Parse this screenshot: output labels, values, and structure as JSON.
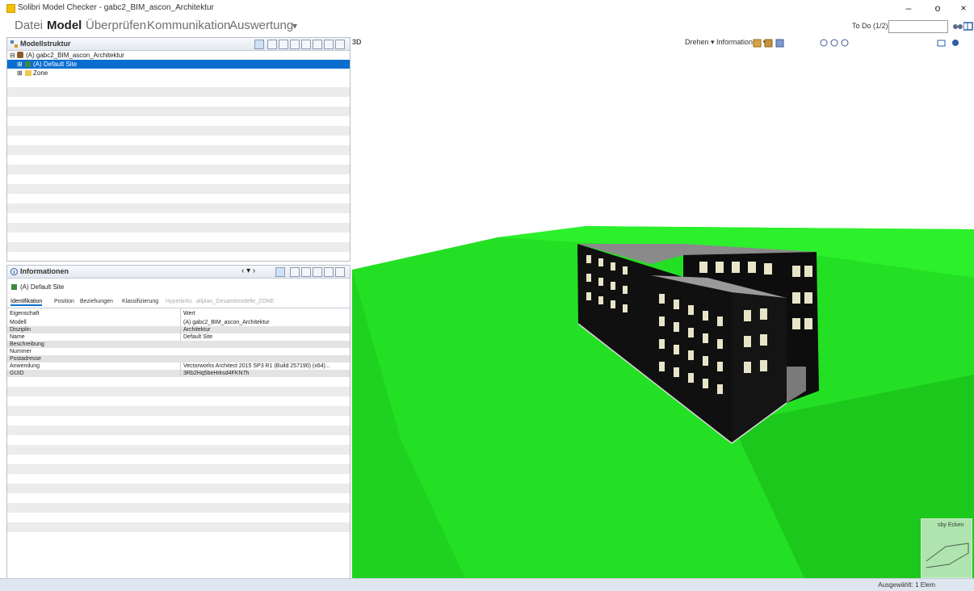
{
  "window": {
    "title": "Solibri Model Checker - gabc2_BIM_ascon_Architektur",
    "minimize": "–",
    "maximize": "o",
    "close": "×"
  },
  "menu": {
    "items": [
      "Datei",
      "Model",
      "Überprüfen",
      "Kommunikation",
      "Auswertung"
    ],
    "more": "▾",
    "todo_label": "To Do (1/2)"
  },
  "model_structure": {
    "title": "Modellstruktur",
    "tree": [
      {
        "label": "(A) gabc2_BIM_ascon_Architektur",
        "level": 0,
        "selected": false
      },
      {
        "label": "(A) Default Site",
        "level": 1,
        "selected": true
      },
      {
        "label": "Zone",
        "level": 1,
        "selected": false
      }
    ]
  },
  "information": {
    "title": "Informationen",
    "item": "(A) Default Site",
    "tabs": [
      "Identifikation",
      "Position",
      "Beziehungen",
      "Klassifizierung",
      "Hyperlinks",
      "allplan_Gesamtmodelle_ZONE"
    ],
    "columns": [
      "Eigenschaft",
      "Wert"
    ],
    "rows": [
      {
        "key": "Modell",
        "value": "(A) gabc2_BIM_ascon_Architektur"
      },
      {
        "key": "Disziplin",
        "value": "Architektur"
      },
      {
        "key": "Name",
        "value": "Default Site"
      },
      {
        "key": "Beschreibung",
        "value": ""
      },
      {
        "key": "Nummer",
        "value": ""
      },
      {
        "key": "Postadresse",
        "value": ""
      },
      {
        "key": "Anwendung",
        "value": "Vectorworks Architect 2015 SP3 R1 (Build 257190) (x64)..."
      },
      {
        "key": "GUID",
        "value": "3Rb2Hq5beHrksd4FKN7h"
      }
    ]
  },
  "viewport": {
    "label_3d": "3D",
    "toolbar_text": "Drehen ▾  Informationen ▾",
    "navcube_label": "sby Ecken",
    "colors": {
      "terrain": "#22e022",
      "terrain_dark": "#12b812",
      "building": "#111111",
      "roof": "#8c8c8c",
      "window": "#e8e4c8"
    }
  },
  "status": {
    "text": "Ausgewählt: 1 Elem"
  }
}
